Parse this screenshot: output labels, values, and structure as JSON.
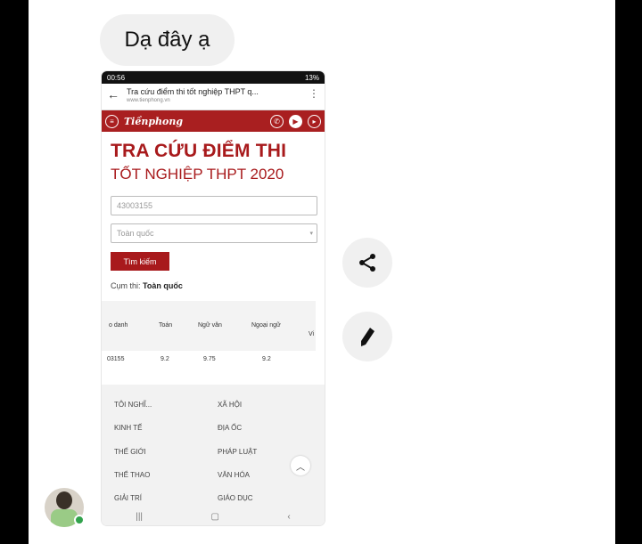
{
  "message": {
    "text": "Dạ đây ạ"
  },
  "phone": {
    "status": {
      "time": "00:56",
      "battery": "13%"
    },
    "browser": {
      "title": "Tra cứu điểm thi tốt nghiệp THPT q...",
      "url": "www.tienphong.vn"
    },
    "brand": {
      "logo_text": "Tiềnphong"
    },
    "page": {
      "heading1": "TRA CỨU ĐIỂM THI",
      "heading2": "TỐT NGHIỆP THPT 2020",
      "input_value": "43003155",
      "select_value": "Toàn quốc",
      "search_button": "Tìm kiếm",
      "cum_label": "Cụm thi:",
      "cum_value": "Toàn quốc"
    },
    "table": {
      "headers": [
        "o danh",
        "Toán",
        "Ngữ văn",
        "Ngoại ngữ",
        "Vi"
      ],
      "row": [
        "03155",
        "9.2",
        "9.75",
        "9.2"
      ]
    },
    "menu": {
      "left": [
        "TÔI NGHĨ...",
        "KINH TẾ",
        "THẾ GIỚI",
        "THỂ THAO",
        "GIẢI TRÍ"
      ],
      "right": [
        "XÃ HỘI",
        "ĐỊA ỐC",
        "PHÁP LUẬT",
        "VĂN HÓA",
        "GIÁO DỤC"
      ]
    }
  },
  "actions": {
    "share_icon": "share-icon",
    "edit_icon": "pencil-icon"
  },
  "colors": {
    "brand_red": "#a81a1c",
    "online_green": "#31a24c"
  }
}
